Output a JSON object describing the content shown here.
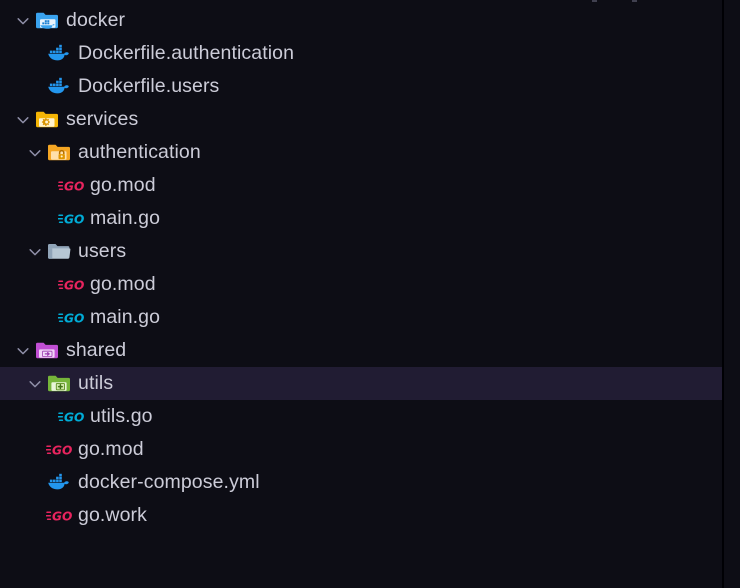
{
  "explorer": {
    "theme": {
      "background": "#0d0d15",
      "selected_row_background": "#211c33",
      "text_color": "#ccccd8",
      "chevron_color": "#8f8fa8",
      "panel_border": "#000004",
      "go_mod_icon_color": "#e8245e",
      "go_file_icon_color": "#00acd7",
      "docker_icon_color": "#2396ed",
      "folder_docker_color": "#3aa3ef",
      "folder_services_color": "#f5b505",
      "folder_auth_color": "#f5a623",
      "folder_plain_color": "#90a4b8",
      "folder_shared_color": "#c14fd4",
      "folder_utils_color": "#76b53a"
    },
    "panel_border_x": 722,
    "tree": [
      {
        "id": "docker-folder",
        "name": "docker",
        "kind": "folder",
        "icon": "folder-docker-icon",
        "indent": 0,
        "expanded": true,
        "selected": false
      },
      {
        "id": "dockerfile-authentication",
        "name": "Dockerfile.authentication",
        "kind": "file",
        "icon": "docker-whale-icon",
        "indent": 1,
        "expanded": null,
        "selected": false
      },
      {
        "id": "dockerfile-users",
        "name": "Dockerfile.users",
        "kind": "file",
        "icon": "docker-whale-icon",
        "indent": 1,
        "expanded": null,
        "selected": false
      },
      {
        "id": "services-folder",
        "name": "services",
        "kind": "folder",
        "icon": "folder-services-icon",
        "indent": 0,
        "expanded": true,
        "selected": false
      },
      {
        "id": "authentication-folder",
        "name": "authentication",
        "kind": "folder",
        "icon": "folder-lock-icon",
        "indent": 1,
        "expanded": true,
        "selected": false
      },
      {
        "id": "services-authentication-go-mod",
        "name": "go.mod",
        "kind": "file",
        "icon": "go-mod-icon",
        "indent": 2,
        "expanded": null,
        "selected": false
      },
      {
        "id": "services-authentication-main-go",
        "name": "main.go",
        "kind": "file",
        "icon": "go-file-icon",
        "indent": 2,
        "expanded": null,
        "selected": false
      },
      {
        "id": "users-folder",
        "name": "users",
        "kind": "folder",
        "icon": "folder-plain-icon",
        "indent": 1,
        "expanded": true,
        "selected": false
      },
      {
        "id": "services-users-go-mod",
        "name": "go.mod",
        "kind": "file",
        "icon": "go-mod-icon",
        "indent": 2,
        "expanded": null,
        "selected": false
      },
      {
        "id": "services-users-main-go",
        "name": "main.go",
        "kind": "file",
        "icon": "go-file-icon",
        "indent": 2,
        "expanded": null,
        "selected": false
      },
      {
        "id": "shared-folder",
        "name": "shared",
        "kind": "folder",
        "icon": "folder-shared-icon",
        "indent": 0,
        "expanded": true,
        "selected": false
      },
      {
        "id": "utils-folder",
        "name": "utils",
        "kind": "folder",
        "icon": "folder-utils-icon",
        "indent": 1,
        "expanded": true,
        "selected": true
      },
      {
        "id": "shared-utils-utils-go",
        "name": "utils.go",
        "kind": "file",
        "icon": "go-file-icon",
        "indent": 2,
        "expanded": null,
        "selected": false
      },
      {
        "id": "shared-go-mod",
        "name": "go.mod",
        "kind": "file",
        "icon": "go-mod-icon",
        "indent": 1,
        "expanded": null,
        "selected": false
      },
      {
        "id": "docker-compose-yml",
        "name": "docker-compose.yml",
        "kind": "file",
        "icon": "docker-whale-icon",
        "indent": 1,
        "expanded": null,
        "selected": false
      },
      {
        "id": "go-work",
        "name": "go.work",
        "kind": "file",
        "icon": "go-mod-icon",
        "indent": 1,
        "expanded": null,
        "selected": false
      }
    ]
  }
}
